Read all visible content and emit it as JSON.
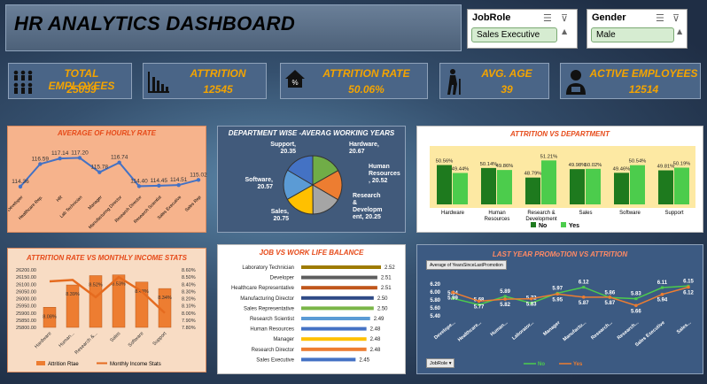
{
  "title": "HR ANALYTICS DASHBOARD",
  "slicers": {
    "jobrole": {
      "label": "JobRole",
      "value": "Sales Executive"
    },
    "gender": {
      "label": "Gender",
      "value": "Male"
    }
  },
  "kpis": {
    "total_employees": {
      "label": "TOTAL EMPLOYEES",
      "value": "25059"
    },
    "attrition": {
      "label": "ATTRITION",
      "value": "12545"
    },
    "attrition_rate": {
      "label": "ATTRITION RATE",
      "value": "50.06%"
    },
    "avg_age": {
      "label": "AVG. AGE",
      "value": "39"
    },
    "active_employees": {
      "label": "ACTIVE EMPLOYEES",
      "value": "12514"
    }
  },
  "colors": {
    "kpi_text": "#f4a400",
    "panel_title": "#e64a19",
    "green_dark": "#1e7a1e",
    "green_light": "#4ccc4c",
    "orange": "#ed7d31",
    "blue": "#4472c4"
  },
  "chart_data": [
    {
      "id": "hourly",
      "type": "line",
      "title": "AVERAGE OF HOURLY RATE",
      "categories": [
        "Developer",
        "Healthcare Rep.",
        "HR",
        "Lab Technician",
        "Manager",
        "Manufacturing Director",
        "Research Director",
        "Research Scientist",
        "Sales Executive",
        "Sales Rep"
      ],
      "values": [
        114.36,
        116.59,
        117.14,
        117.2,
        115.78,
        116.74,
        114.4,
        114.45,
        114.51,
        115.02
      ],
      "labels": [
        "114.36",
        "116.59",
        "117.14",
        "117.20",
        "115.78",
        "116.74",
        "114.40",
        "114.45",
        "114.51",
        "115.02"
      ]
    },
    {
      "id": "dept_years",
      "type": "pie",
      "title": "DEPARTMENT WISE -AVERAG WORKING YEARS",
      "categories": [
        "Hardware",
        "Human Resources",
        "Research & Development",
        "Sales",
        "Software",
        "Support"
      ],
      "values": [
        20.67,
        20.52,
        20.25,
        20.75,
        20.57,
        20.35
      ],
      "label_lines": [
        [
          "Hardware,",
          "20.67"
        ],
        [
          "Human",
          "Resources",
          ", 20.52"
        ],
        [
          "Research",
          "&",
          "Developm",
          "ent, 20.25"
        ],
        [
          "Sales,",
          "20.75"
        ],
        [
          "Software,",
          "20.57"
        ],
        [
          "Support,",
          "20.35"
        ]
      ],
      "colors": [
        "#70ad47",
        "#ed7d31",
        "#a5a5a5",
        "#ffc000",
        "#5b9bd5",
        "#4472c4"
      ]
    },
    {
      "id": "attr_dept",
      "type": "bar",
      "title": "ATTRITION VS DEPARTMENT",
      "categories": [
        "Hardware",
        "Human Resources",
        "Research & Development",
        "Sales",
        "Software",
        "Support"
      ],
      "category_lines": [
        [
          "Hardware"
        ],
        [
          "Human",
          "Resources"
        ],
        [
          "Research &",
          "Development"
        ],
        [
          "Sales"
        ],
        [
          "Software"
        ],
        [
          "Support"
        ]
      ],
      "series": [
        {
          "name": "No",
          "values": [
            50.56,
            50.14,
            48.79,
            49.98,
            49.46,
            49.81
          ],
          "labels": [
            "50.56%",
            "50.14%",
            "48.79%",
            "49.98%",
            "49.46%",
            "49.81%"
          ]
        },
        {
          "name": "Yes",
          "values": [
            49.44,
            49.86,
            51.21,
            50.02,
            50.54,
            50.19
          ],
          "labels": [
            "49.44%",
            "49.86%",
            "51.21%",
            "50.02%",
            "50.54%",
            "50.19%"
          ]
        }
      ]
    },
    {
      "id": "income",
      "type": "bar",
      "title": "ATTRITION RATE VS MONTHLY INCOME STATS",
      "categories": [
        "Hardware",
        "Human...",
        "Research &...",
        "Sales",
        "Software",
        "Support"
      ],
      "series": [
        {
          "name": "Attrition Rtae",
          "axis": "right",
          "values": [
            8.08,
            8.39,
            8.52,
            8.53,
            8.43,
            8.34
          ],
          "labels": [
            "8.08%",
            "8.39%",
            "8.52%",
            "8.53%",
            "8.43%",
            "8.34%"
          ]
        },
        {
          "name": "Monthly Income Stats",
          "type": "line",
          "axis": "left",
          "values": [
            26120,
            26130,
            26010,
            26150,
            26050,
            25900
          ]
        }
      ],
      "y_left_ticks": [
        "26200.00",
        "26150.00",
        "26100.00",
        "26050.00",
        "26000.00",
        "25950.00",
        "25900.00",
        "25850.00",
        "25800.00"
      ],
      "y_right_ticks": [
        "8.60%",
        "8.50%",
        "8.40%",
        "8.30%",
        "8.20%",
        "8.10%",
        "8.00%",
        "7.90%",
        "7.80%"
      ],
      "ylim_left": [
        25800,
        26200
      ],
      "ylim_right": [
        7.8,
        8.6
      ]
    },
    {
      "id": "wlb",
      "type": "bar",
      "title": "JOB VS WORK LIFE BALANCE",
      "categories": [
        "Laboratory Technician",
        "Developer",
        "Healthcare Representative",
        "Manufacturing Director",
        "Sales Representative",
        "Research Scientist",
        "Human Resources",
        "Manager",
        "Research Director",
        "Sales Executive"
      ],
      "values": [
        2.52,
        2.51,
        2.51,
        2.5,
        2.5,
        2.49,
        2.48,
        2.48,
        2.48,
        2.45
      ],
      "labels": [
        "2.52",
        "2.51",
        "2.51",
        "2.50",
        "2.50",
        "2.49",
        "2.48",
        "2.48",
        "2.48",
        "2.45"
      ],
      "colors": [
        "#9e7b00",
        "#5e5e5e",
        "#c0561b",
        "#2e4a86",
        "#7ab648",
        "#5b9bd5",
        "#4472c4",
        "#ffc000",
        "#ed7d31",
        "#4472c4"
      ]
    },
    {
      "id": "promo",
      "type": "line",
      "title": "LAST YEAR PROMoTION VS ATTRITION",
      "field_button": "Average of YearsSinceLastPromotion",
      "filter_button": "JobRole",
      "categories": [
        "Develope...",
        "Healthcare...",
        "Human...",
        "Laborator...",
        "Manager",
        "Manufactu...",
        "Research...",
        "Research...",
        "Sales Executive",
        "Sales..."
      ],
      "y_ticks": [
        "6.20",
        "6.00",
        "5.80",
        "5.60",
        "5.40"
      ],
      "ylim": [
        5.4,
        6.2
      ],
      "series": [
        {
          "name": "No",
          "values": [
            5.84,
            5.68,
            5.89,
            5.72,
            5.97,
            6.12,
            5.86,
            5.83,
            6.11,
            6.15
          ],
          "labels": [
            "5.84",
            "5.68",
            "5.89",
            "5.72",
            "5.97",
            "6.12",
            "5.86",
            "5.83",
            "6.11",
            "6.15"
          ]
        },
        {
          "name": "Yes",
          "values": [
            5.99,
            5.77,
            5.82,
            5.83,
            5.95,
            5.87,
            5.87,
            5.66,
            5.94,
            6.12
          ],
          "labels": [
            "5.99",
            "5.77",
            "5.82",
            "5.83",
            "5.95",
            "5.87",
            "5.87",
            "5.66",
            "5.94",
            "6.12"
          ]
        }
      ]
    }
  ]
}
